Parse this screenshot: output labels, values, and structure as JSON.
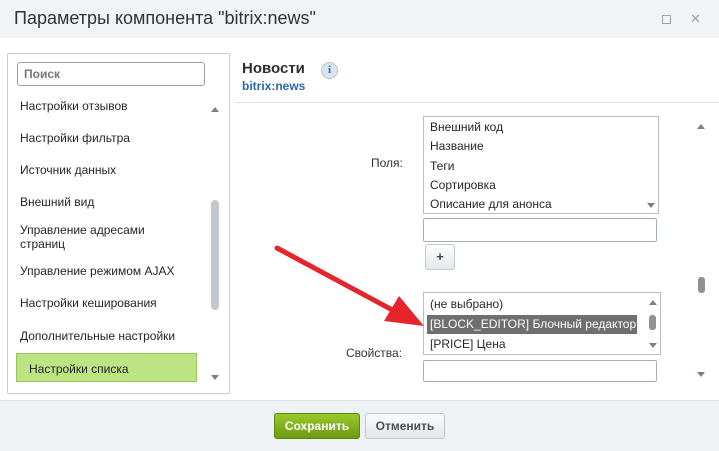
{
  "window": {
    "title": "Параметры компонента \"bitrix:news\"",
    "maximize_icon": "maximize-icon",
    "close_icon": "close-icon"
  },
  "sidebar": {
    "search_placeholder": "Поиск",
    "items": [
      {
        "label": "Настройки отзывов"
      },
      {
        "label": "Настройки фильтра"
      },
      {
        "label": "Источник данных"
      },
      {
        "label": "Внешний вид"
      },
      {
        "label": "Управление адресами страниц"
      },
      {
        "label": "Управление режимом AJAX"
      },
      {
        "label": "Настройки кеширования"
      },
      {
        "label": "Дополнительные настройки"
      },
      {
        "label": "Настройки списка",
        "active": true
      }
    ]
  },
  "component": {
    "name": "Новости",
    "code": "bitrix:news"
  },
  "fields": {
    "label": "Поля:",
    "options": [
      "Внешний код",
      "Название",
      "Теги",
      "Сортировка",
      "Описание для анонса"
    ],
    "add_label": "+"
  },
  "properties": {
    "label": "Свойства:",
    "options": [
      "(не выбрано)",
      "[BLOCK_EDITOR] Блочный редактор",
      "[PRICE] Цена"
    ],
    "selected_index": 1
  },
  "footer": {
    "save_label": "Сохранить",
    "cancel_label": "Отменить"
  },
  "colors": {
    "accent_green": "#8cbf26",
    "active_item": "#bde482",
    "callout_arrow": "#e5242b",
    "link_blue": "#2a69a8"
  }
}
